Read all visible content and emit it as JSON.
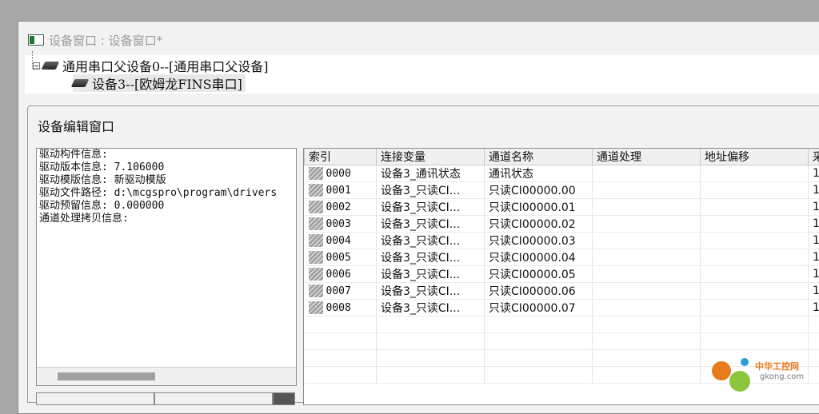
{
  "window": {
    "title": "设备窗口 : 设备窗口*"
  },
  "tree": {
    "root_label": "通用串口父设备0--[通用串口父设备]",
    "child_label": "设备3--[欧姆龙FINS串口]"
  },
  "editor": {
    "title": "设备编辑窗口",
    "info_lines": [
      "驱动构件信息:",
      "驱动版本信息: 7.106000",
      "驱动模版信息: 新驱动模版",
      "驱动文件路径: d:\\mcgspro\\program\\drivers",
      "驱动预留信息: 0.000000",
      "通道处理拷贝信息:"
    ]
  },
  "grid": {
    "columns": [
      "索引",
      "连接变量",
      "通道名称",
      "通道处理",
      "地址偏移",
      "采"
    ],
    "rows": [
      {
        "index": "0000",
        "variable": "设备3_通讯状态",
        "channel": "通讯状态",
        "process": "",
        "offset": "",
        "extra": "1"
      },
      {
        "index": "0001",
        "variable": "设备3_只读CI...",
        "channel": "只读CI00000.00",
        "process": "",
        "offset": "",
        "extra": "1"
      },
      {
        "index": "0002",
        "variable": "设备3_只读CI...",
        "channel": "只读CI00000.01",
        "process": "",
        "offset": "",
        "extra": "1"
      },
      {
        "index": "0003",
        "variable": "设备3_只读CI...",
        "channel": "只读CI00000.02",
        "process": "",
        "offset": "",
        "extra": "1"
      },
      {
        "index": "0004",
        "variable": "设备3_只读CI...",
        "channel": "只读CI00000.03",
        "process": "",
        "offset": "",
        "extra": "1"
      },
      {
        "index": "0005",
        "variable": "设备3_只读CI...",
        "channel": "只读CI00000.04",
        "process": "",
        "offset": "",
        "extra": "1"
      },
      {
        "index": "0006",
        "variable": "设备3_只读CI...",
        "channel": "只读CI00000.05",
        "process": "",
        "offset": "",
        "extra": "1"
      },
      {
        "index": "0007",
        "variable": "设备3_只读CI...",
        "channel": "只读CI00000.06",
        "process": "",
        "offset": "",
        "extra": "1"
      },
      {
        "index": "0008",
        "variable": "设备3_只读CI...",
        "channel": "只读CI00000.07",
        "process": "",
        "offset": "",
        "extra": "1"
      }
    ],
    "empty_rows": 4
  },
  "watermark": {
    "brand": "中华工控网",
    "url": "gkong.com"
  },
  "colors": {
    "watermark_orange": "#e87b1e",
    "watermark_green": "#8cc63f",
    "watermark_blue": "#2a9fd6"
  }
}
